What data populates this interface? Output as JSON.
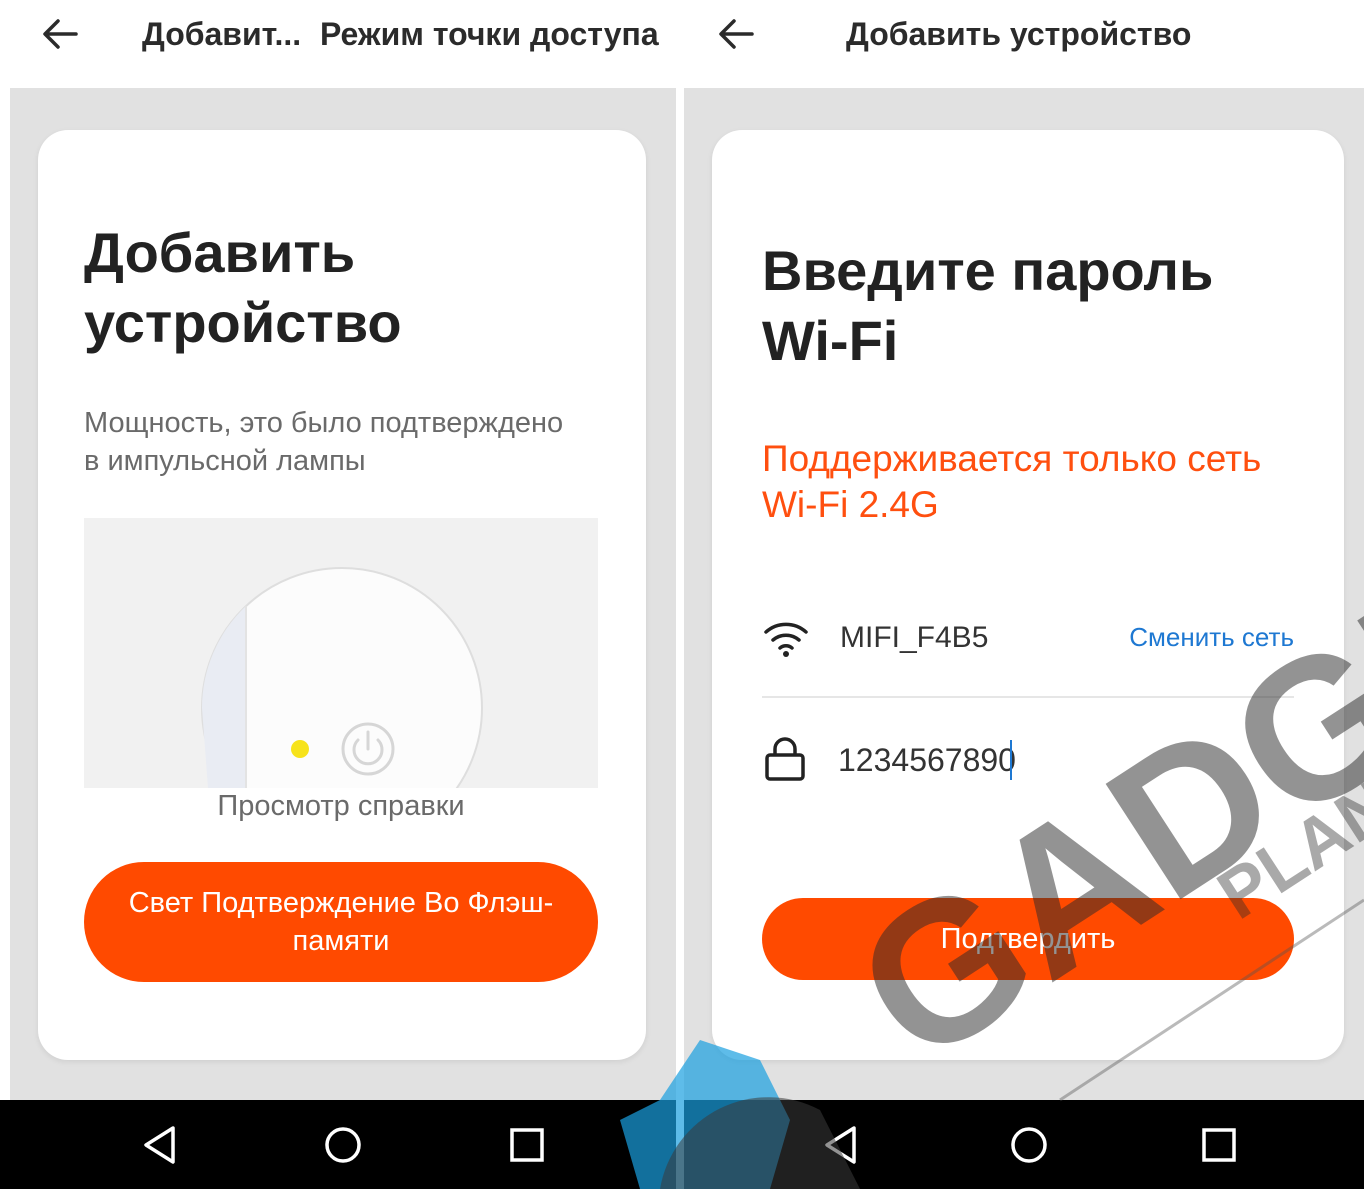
{
  "left_screen": {
    "topbar": {
      "title_truncated": "Добавит...",
      "title": "Режим точки доступа"
    },
    "card": {
      "heading_line1": "Добавить",
      "heading_line2": "устройство",
      "description_line1": "Мощность, это было подтверждено",
      "description_line2": "в импульсной лампы",
      "help_link": "Просмотр справки",
      "confirm_button_line1": "Свет Подтверждение Во Флэш-",
      "confirm_button_line2": "памяти"
    }
  },
  "right_screen": {
    "topbar": {
      "title": "Добавить устройство"
    },
    "card": {
      "heading_line1": "Введите пароль",
      "heading_line2": "Wi-Fi",
      "warning_line1": "Поддерживается только сеть",
      "warning_line2": "Wi-Fi 2.4G",
      "ssid": "MIFI_F4B5",
      "change_network": "Сменить сеть",
      "password": "1234567890",
      "confirm_button": "Подтвердить"
    }
  },
  "watermark": {
    "line1": "GADGET",
    "line2": "PLANET"
  },
  "icons": [
    "back-arrow-icon",
    "wifi-icon",
    "lock-icon",
    "power-icon",
    "nav-back-icon",
    "nav-home-icon",
    "nav-recents-icon"
  ],
  "colors": {
    "accent": "#ff4a00",
    "warning": "#ff4f0f",
    "link": "#1e78d2",
    "background": "#e1e1e1",
    "navbar": "#000000"
  }
}
